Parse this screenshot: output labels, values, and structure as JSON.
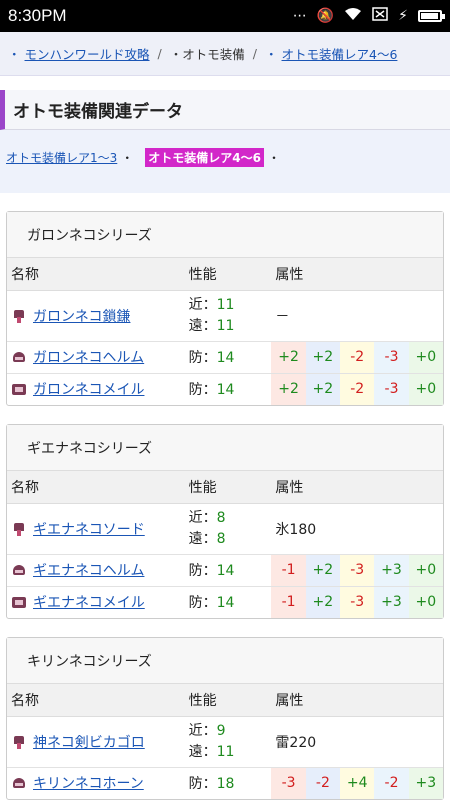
{
  "status": {
    "time": "8:30PM"
  },
  "breadcrumb": {
    "item1": "モンハンワールド攻略",
    "item2": "オトモ装備",
    "item3": "オトモ装備レア4～6",
    "sep": "/",
    "bullet": "・"
  },
  "section": {
    "title": "オトモ装備関連データ",
    "link1": "オトモ装備レア1～3",
    "link2": "オトモ装備レア4～6",
    "bullet": "・"
  },
  "headers": {
    "name": "名称",
    "perf": "性能",
    "attr": "属性"
  },
  "colors": {
    "accent": "#9b45c9",
    "active_link": "#d227c9",
    "positive": "#1e8a1e",
    "negative": "#d21e1e"
  },
  "series": [
    {
      "title": "ガロンネコシリーズ",
      "weapon": {
        "name": "ガロンネコ鎖鎌",
        "near_label": "近：",
        "near": "11",
        "far_label": "遠：",
        "far": "11",
        "attr": "－"
      },
      "helm": {
        "name": "ガロンネコヘルム",
        "def_label": "防：",
        "def": "14",
        "res": [
          "+2",
          "+2",
          "-2",
          "-3",
          "+0"
        ]
      },
      "armor": {
        "name": "ガロンネコメイル",
        "def_label": "防：",
        "def": "14",
        "res": [
          "+2",
          "+2",
          "-2",
          "-3",
          "+0"
        ]
      }
    },
    {
      "title": "ギエナネコシリーズ",
      "weapon": {
        "name": "ギエナネコソード",
        "near_label": "近：",
        "near": "8",
        "far_label": "遠：",
        "far": "8",
        "attr": "氷180"
      },
      "helm": {
        "name": "ギエナネコヘルム",
        "def_label": "防：",
        "def": "14",
        "res": [
          "-1",
          "+2",
          "-3",
          "+3",
          "+0"
        ]
      },
      "armor": {
        "name": "ギエナネコメイル",
        "def_label": "防：",
        "def": "14",
        "res": [
          "-1",
          "+2",
          "-3",
          "+3",
          "+0"
        ]
      }
    },
    {
      "title": "キリンネコシリーズ",
      "weapon": {
        "name": "神ネコ剣ビカゴロ",
        "near_label": "近：",
        "near": "9",
        "far_label": "遠：",
        "far": "11",
        "attr": "雷220"
      },
      "helm": {
        "name": "キリンネコホーン",
        "def_label": "防：",
        "def": "18",
        "res": [
          "-3",
          "-2",
          "+4",
          "-2",
          "+3"
        ]
      }
    }
  ]
}
